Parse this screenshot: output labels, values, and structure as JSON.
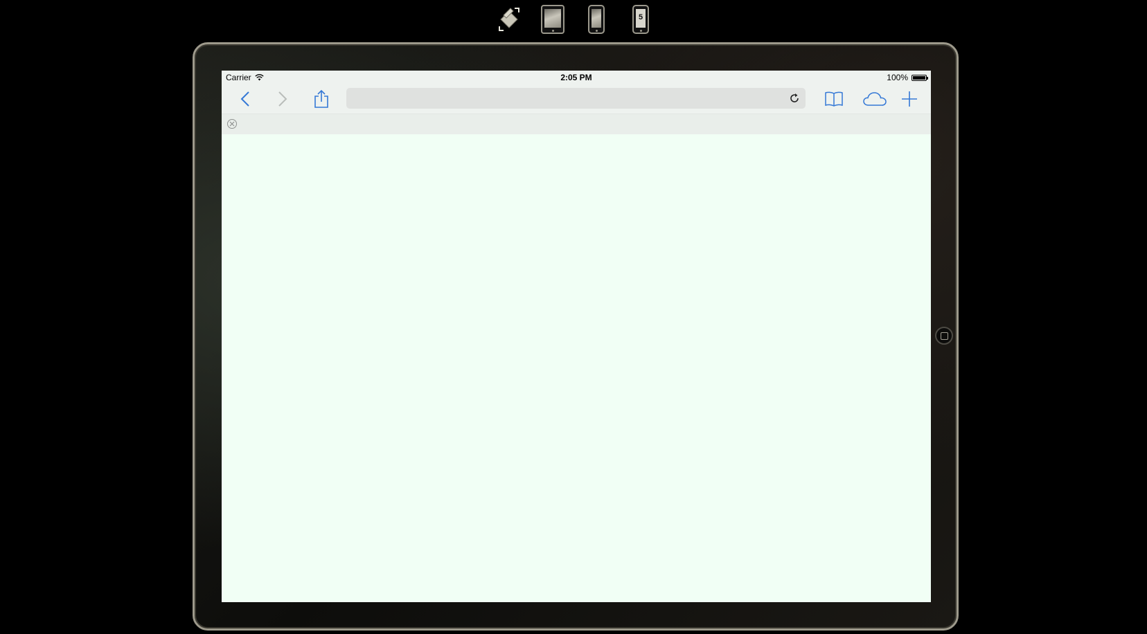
{
  "simulator_toolbar": {
    "rotate": {
      "icon": "rotate-device-icon"
    },
    "devices": [
      {
        "name": "ipad",
        "icon": "ipad-icon",
        "label": ""
      },
      {
        "name": "iphone",
        "icon": "iphone-icon",
        "label": ""
      },
      {
        "name": "iphone5",
        "icon": "iphone5-icon",
        "label": "5"
      }
    ]
  },
  "status_bar": {
    "carrier": "Carrier",
    "time": "2:05 PM",
    "battery": "100%",
    "battery_level": 1.0
  },
  "nav_bar": {
    "url": "",
    "icons": {
      "back": "chevron-left-icon",
      "forward": "chevron-right-icon",
      "share": "share-icon",
      "reload": "reload-icon",
      "bookmarks": "book-icon",
      "cloud": "cloud-icon",
      "add_tab": "plus-icon"
    }
  },
  "tab_bar": {
    "tabs": [
      {
        "title": ""
      }
    ]
  },
  "colors": {
    "accent": "#3478d6",
    "disabled": "#b9bdba",
    "content_background": "#f1fff5",
    "bar_background": "#eef2ef",
    "frame_border": "#9d998b"
  }
}
